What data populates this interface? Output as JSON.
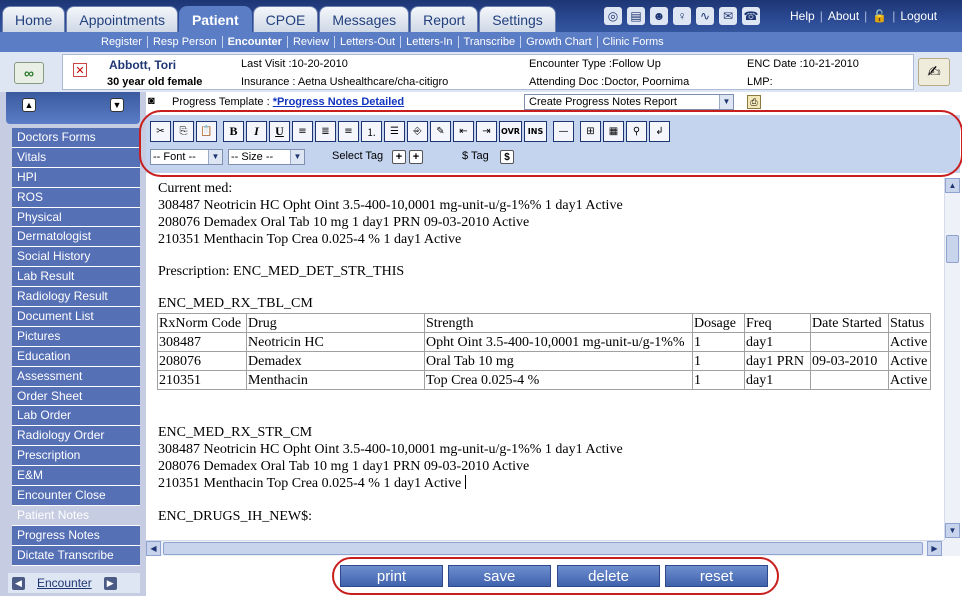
{
  "nav": {
    "tabs": [
      "Home",
      "Appointments",
      "Patient",
      "CPOE",
      "Messages",
      "Report",
      "Settings"
    ],
    "active_tab": "Patient",
    "links": {
      "help": "Help",
      "about": "About",
      "logout": "Logout"
    },
    "icons": [
      "glasses-icon",
      "bill-icon",
      "doctor-icon",
      "nurse-icon",
      "stethoscope-icon",
      "mail-icon",
      "phone-icon"
    ]
  },
  "subnav": {
    "items": [
      "Register",
      "Resp Person",
      "Encounter",
      "Review",
      "Letters-Out",
      "Letters-In",
      "Transcribe",
      "Growth Chart",
      "Clinic Forms"
    ],
    "active": "Encounter"
  },
  "patient": {
    "name": "Abbott, Tori",
    "age_text": "30 year old female",
    "last_visit": "Last Visit :10-20-2010",
    "insurance": "Insurance : Aetna Ushealthcare/cha-citigro",
    "encounter_type": "Encounter Type :Follow Up",
    "attending": "Attending Doc :Doctor, Poornima",
    "enc_date": "ENC Date :10-21-2010",
    "lmp": "LMP:"
  },
  "sidebar": {
    "items": [
      "Doctors Forms",
      "Vitals",
      "HPI",
      "ROS",
      "Physical",
      "Dermatologist",
      "Social History",
      "Lab Result",
      "Radiology Result",
      "Document List",
      "Pictures",
      "Education",
      "Assessment",
      "Order Sheet",
      "Lab Order",
      "Radiology Order",
      "Prescription",
      "E&M",
      "Encounter Close",
      "Patient Notes",
      "Progress Notes",
      "Dictate Transcribe"
    ],
    "active": "Patient Notes",
    "footer_link": "Encounter"
  },
  "template": {
    "label": "Progress Template :",
    "link": "*Progress Notes Detailed",
    "report_select": "Create Progress Notes Report"
  },
  "toolbar": {
    "buttons": [
      "cut",
      "copy",
      "paste",
      "bold",
      "italic",
      "underline",
      "align-left",
      "align-center",
      "align-right",
      "numbered-list",
      "bullet-list",
      "format",
      "highlight",
      "outdent",
      "indent",
      "OVR",
      "INS",
      "horizontal-rule",
      "table",
      "insert-field",
      "find",
      "line-break"
    ],
    "bold_glyph": "B",
    "italic_glyph": "I",
    "underline_glyph": "U",
    "ovr_label": "OVR",
    "ins_label": "INS",
    "font_select": "-- Font --",
    "size_select": "-- Size --",
    "select_tag_label": "Select Tag",
    "dollar_tag_label": "$ Tag"
  },
  "editor": {
    "current_med_heading": "Current med:",
    "current_med_lines": [
      "308487 Neotricin HC Opht Oint 3.5-400-10,0001 mg-unit-u/g-1%% 1 day1 Active",
      "208076 Demadex Oral Tab 10 mg 1 day1 PRN 09-03-2010 Active",
      "210351 Menthacin Top Crea 0.025-4 % 1 day1 Active"
    ],
    "prescription_line": "Prescription: ENC_MED_DET_STR_THIS",
    "table_tag": "ENC_MED_RX_TBL_CM",
    "table": {
      "headers": [
        "RxNorm Code",
        "Drug",
        "Strength",
        "Dosage",
        "Freq",
        "Date Started",
        "Status"
      ],
      "rows": [
        [
          "308487",
          "Neotricin HC",
          "Opht Oint 3.5-400-10,0001 mg-unit-u/g-1%%",
          "1",
          "day1",
          "",
          "Active"
        ],
        [
          "208076",
          "Demadex",
          "Oral Tab 10 mg",
          "1",
          "day1 PRN",
          "09-03-2010",
          "Active"
        ],
        [
          "210351",
          "Menthacin",
          "Top Crea 0.025-4 %",
          "1",
          "day1",
          "",
          "Active"
        ]
      ]
    },
    "str_tag": "ENC_MED_RX_STR_CM",
    "str_lines": [
      "308487 Neotricin HC Opht Oint 3.5-400-10,0001 mg-unit-u/g-1%% 1 day1 Active",
      "208076 Demadex Oral Tab 10 mg 1 day1 PRN 09-03-2010 Active",
      "210351 Menthacin Top Crea 0.025-4 % 1 day1 Active"
    ],
    "drugs_tag": "ENC_DRUGS_IH_NEW$:"
  },
  "actions": {
    "print": "print",
    "save": "save",
    "delete": "delete",
    "reset": "reset"
  },
  "colors": {
    "nav_dark": "#1d3573",
    "accent": "#5b7dc6",
    "sidebar_item": "#5670b6",
    "highlight_oval": "#c81e1e",
    "toolbar_bg": "#c4d4ee"
  }
}
